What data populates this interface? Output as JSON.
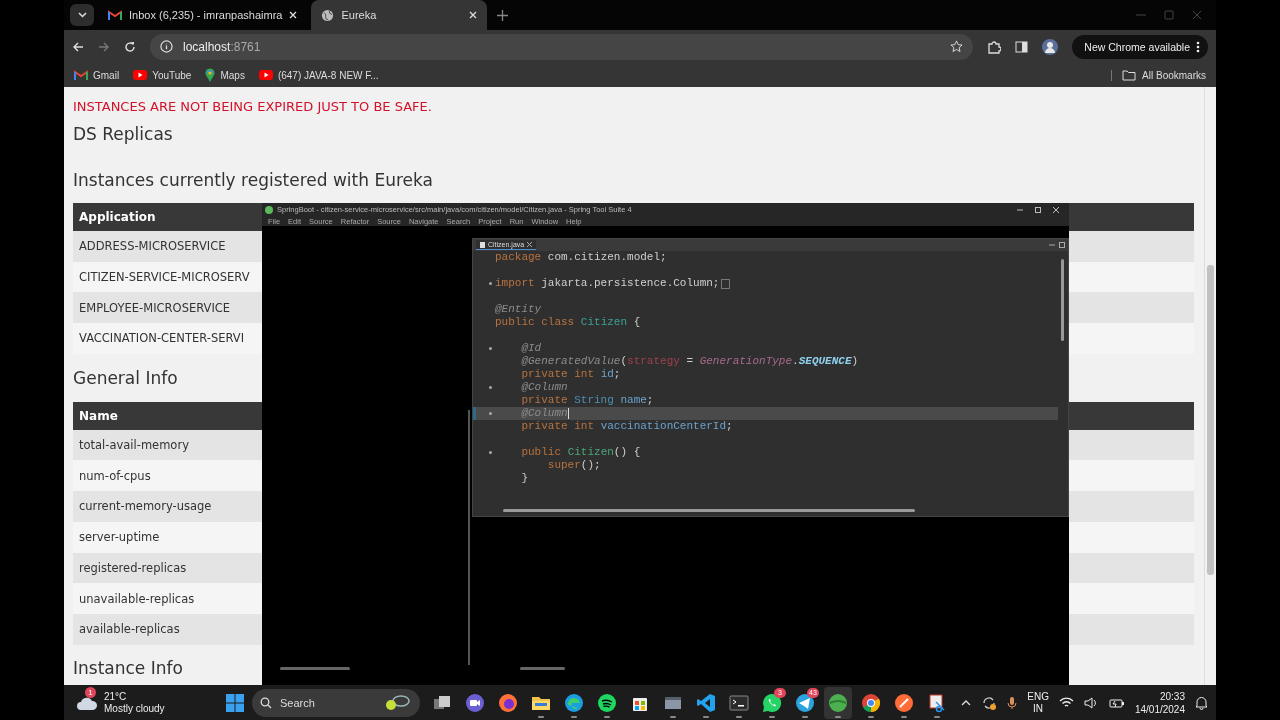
{
  "browser": {
    "tabs": [
      {
        "title": "Inbox (6,235) - imranpashaimra",
        "kind": "mail",
        "selected": false
      },
      {
        "title": "Eureka",
        "kind": "web",
        "selected": true
      }
    ],
    "address": {
      "host": "localhost",
      "port": ":8761"
    },
    "update_button": "New Chrome available",
    "bookmarks": [
      {
        "label": "Gmail",
        "kind": "mail"
      },
      {
        "label": "YouTube",
        "kind": "video"
      },
      {
        "label": "Maps",
        "kind": "map"
      },
      {
        "label": "(647) JAVA-8 NEW F...",
        "kind": "video"
      }
    ],
    "all_bookmarks": "All Bookmarks"
  },
  "page": {
    "warning": "INSTANCES ARE NOT BEING EXPIRED JUST TO BE SAFE.",
    "replicas_title": "DS Replicas",
    "instances_title": "Instances currently registered with Eureka",
    "instances_table": {
      "columns": [
        "Application"
      ],
      "rows": [
        "ADDRESS-MICROSERVICE",
        "CITIZEN-SERVICE-MICROSERV",
        "EMPLOYEE-MICROSERVICE",
        "VACCINATION-CENTER-SERVI"
      ]
    },
    "general_title": "General Info",
    "general_table": {
      "columns": [
        "Name"
      ],
      "rows": [
        "total-avail-memory",
        "num-of-cpus",
        "current-memory-usage",
        "server-uptime",
        "registered-replicas",
        "unavailable-replicas",
        "available-replicas"
      ]
    },
    "instance_title": "Instance Info"
  },
  "ide": {
    "title": "SpringBoot - citizen-service-microservice/src/main/java/com/citizen/model/Citizen.java - Spring Tool Suite 4",
    "menu": [
      "File",
      "Edit",
      "Source",
      "Refactor",
      "Source",
      "Navigate",
      "Search",
      "Project",
      "Run",
      "Window",
      "Help"
    ],
    "editor_tab": "Citizen.java",
    "lines": [
      {
        "kind": "code",
        "marker": false,
        "current": false,
        "folded": false,
        "tokens": [
          {
            "text": "package",
            "kind": "kw"
          },
          {
            "text": " com.citizen.model;",
            "kind": "txt"
          }
        ]
      },
      {
        "kind": "blank"
      },
      {
        "kind": "code",
        "marker": true,
        "current": false,
        "folded": true,
        "tokens": [
          {
            "text": "import",
            "kind": "kw"
          },
          {
            "text": " jakarta.persistence.Column;",
            "kind": "txt"
          }
        ]
      },
      {
        "kind": "blank"
      },
      {
        "kind": "code",
        "marker": false,
        "current": false,
        "folded": false,
        "tokens": [
          {
            "text": "@Entity",
            "kind": "ann"
          }
        ]
      },
      {
        "kind": "code",
        "marker": false,
        "current": false,
        "folded": false,
        "tokens": [
          {
            "text": "public class ",
            "kind": "kw"
          },
          {
            "text": "Citizen",
            "kind": "cls"
          },
          {
            "text": " {",
            "kind": "txt"
          }
        ]
      },
      {
        "kind": "blank"
      },
      {
        "kind": "code",
        "marker": true,
        "current": false,
        "folded": false,
        "tokens": [
          {
            "text": "    @Id",
            "kind": "ann"
          }
        ]
      },
      {
        "kind": "code",
        "marker": false,
        "current": false,
        "folded": false,
        "tokens": [
          {
            "text": "    @GeneratedValue",
            "kind": "ann"
          },
          {
            "text": "(",
            "kind": "txt"
          },
          {
            "text": "strategy",
            "kind": "param"
          },
          {
            "text": " = ",
            "kind": "txt"
          },
          {
            "text": "GenerationType",
            "kind": "enum"
          },
          {
            "text": ".",
            "kind": "txt"
          },
          {
            "text": "SEQUENCE",
            "kind": "const"
          },
          {
            "text": ")",
            "kind": "txt"
          }
        ]
      },
      {
        "kind": "code",
        "marker": false,
        "current": false,
        "folded": false,
        "tokens": [
          {
            "text": "    private int ",
            "kind": "kw"
          },
          {
            "text": "id",
            "kind": "fld"
          },
          {
            "text": ";",
            "kind": "txt"
          }
        ]
      },
      {
        "kind": "code",
        "marker": true,
        "current": false,
        "folded": false,
        "tokens": [
          {
            "text": "    @Column",
            "kind": "ann"
          }
        ]
      },
      {
        "kind": "code",
        "marker": false,
        "current": false,
        "folded": false,
        "tokens": [
          {
            "text": "    private ",
            "kind": "kw"
          },
          {
            "text": "String ",
            "kind": "type"
          },
          {
            "text": "name",
            "kind": "fld"
          },
          {
            "text": ";",
            "kind": "txt"
          }
        ]
      },
      {
        "kind": "code",
        "marker": true,
        "current": true,
        "folded": false,
        "tokens": [
          {
            "text": "    @Column",
            "kind": "ann"
          }
        ]
      },
      {
        "kind": "code",
        "marker": false,
        "current": false,
        "folded": false,
        "tokens": [
          {
            "text": "    private int ",
            "kind": "kw"
          },
          {
            "text": "vaccinationCenterId",
            "kind": "fld"
          },
          {
            "text": ";",
            "kind": "txt"
          }
        ]
      },
      {
        "kind": "blank"
      },
      {
        "kind": "code",
        "marker": true,
        "current": false,
        "folded": false,
        "tokens": [
          {
            "text": "    public ",
            "kind": "kw"
          },
          {
            "text": "Citizen",
            "kind": "ctor"
          },
          {
            "text": "() {",
            "kind": "txt"
          }
        ]
      },
      {
        "kind": "code",
        "marker": false,
        "current": false,
        "folded": false,
        "tokens": [
          {
            "text": "        super",
            "kind": "kw"
          },
          {
            "text": "();",
            "kind": "txt"
          }
        ]
      },
      {
        "kind": "code",
        "marker": false,
        "current": false,
        "folded": false,
        "tokens": [
          {
            "text": "    }",
            "kind": "txt"
          }
        ]
      }
    ]
  },
  "taskbar": {
    "weather": {
      "badge": "1",
      "temperature": "21°C",
      "condition": "Mostly cloudy"
    },
    "search": "Search",
    "apps": [
      {
        "kind": "taskview",
        "running": false,
        "selected": false
      },
      {
        "kind": "meet",
        "running": false,
        "selected": false
      },
      {
        "kind": "firefox",
        "running": false,
        "selected": false
      },
      {
        "kind": "folder",
        "running": true,
        "selected": false
      },
      {
        "kind": "edge",
        "running": true,
        "selected": false
      },
      {
        "kind": "spotify",
        "running": true,
        "selected": false
      },
      {
        "kind": "store",
        "running": false,
        "selected": false
      },
      {
        "kind": "window",
        "running": true,
        "selected": false
      },
      {
        "kind": "vscode",
        "running": true,
        "selected": false
      },
      {
        "kind": "terminal",
        "running": true,
        "selected": false
      },
      {
        "kind": "whatsapp",
        "running": true,
        "selected": false,
        "badge": "3"
      },
      {
        "kind": "telegram",
        "running": true,
        "selected": false,
        "badge": "43"
      },
      {
        "kind": "sts",
        "running": true,
        "selected": true
      },
      {
        "kind": "chrome",
        "running": true,
        "selected": false
      },
      {
        "kind": "postman",
        "running": true,
        "selected": false
      },
      {
        "kind": "snip",
        "running": true,
        "selected": false
      }
    ],
    "language": "ENG",
    "region": "IN",
    "time": "20:33",
    "date": "14/01/2024"
  }
}
